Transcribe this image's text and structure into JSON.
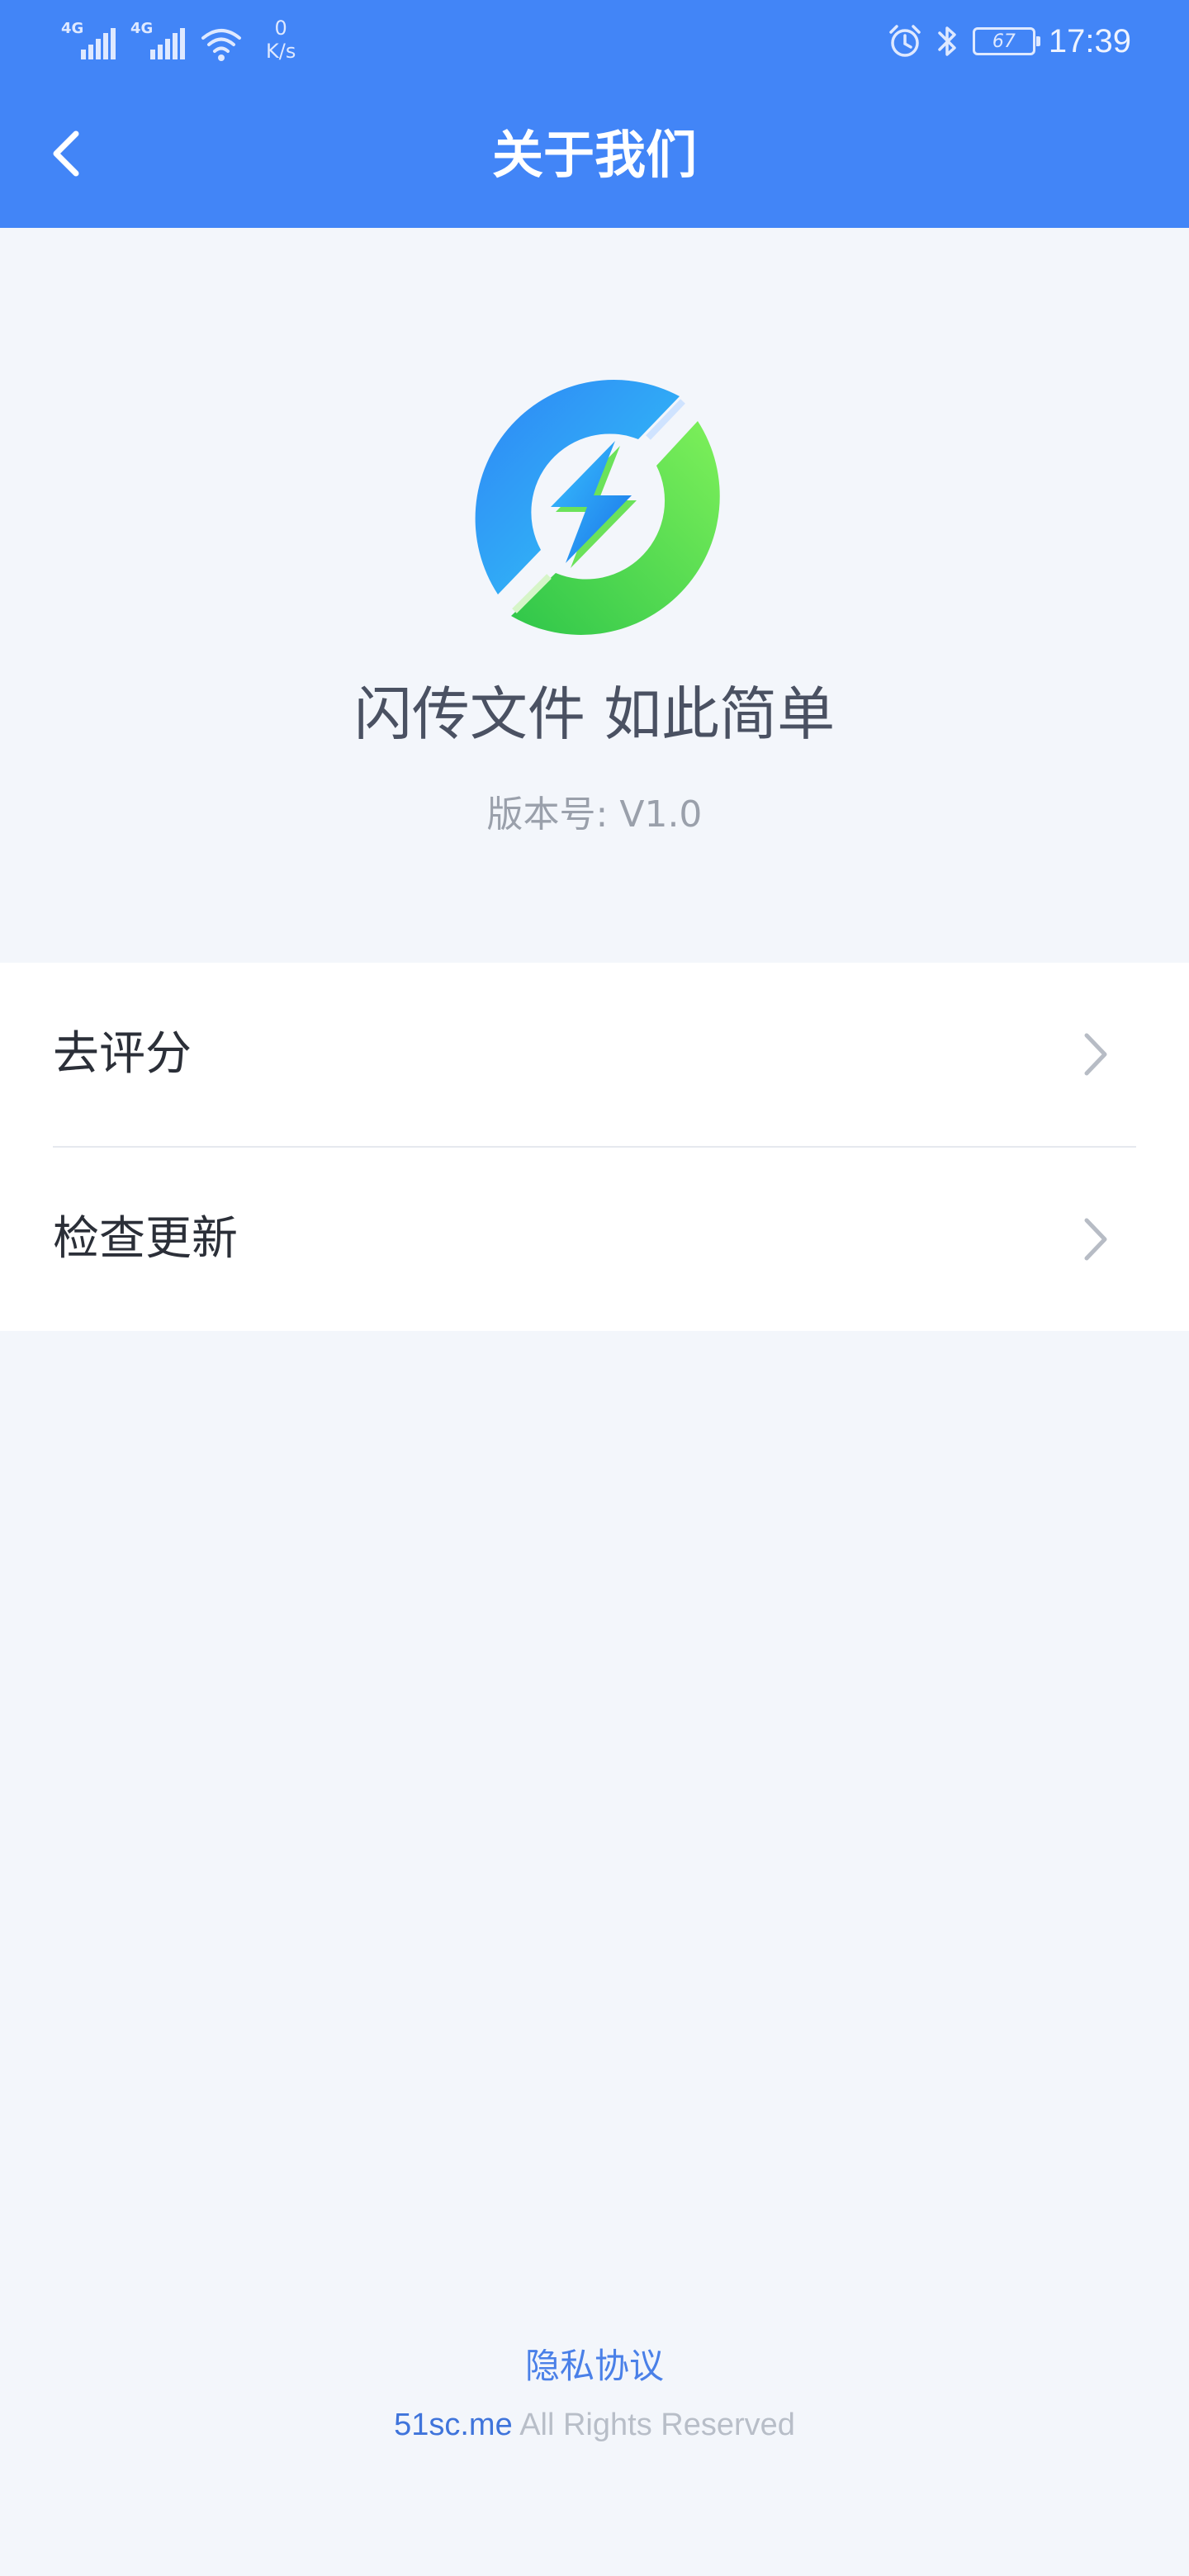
{
  "status_bar": {
    "signal1_tag": "4G",
    "signal2_tag": "4G",
    "net_speed_value": "0",
    "net_speed_unit": "K/s",
    "battery_level": "67",
    "time": "17:39"
  },
  "header": {
    "title": "关于我们",
    "background_color": "#4285f7"
  },
  "about": {
    "slogan": "闪传文件 如此简单",
    "version_label": "版本号: V1.0"
  },
  "menu": {
    "items": [
      {
        "label": "去评分"
      },
      {
        "label": "检查更新"
      }
    ]
  },
  "footer": {
    "privacy_link": "隐私协议",
    "domain": "51sc.me",
    "rights": "All Rights Reserved"
  },
  "icons": {
    "back": "chevron-left-icon",
    "menu_chevron": "chevron-right-icon",
    "alarm": "alarm-icon",
    "bluetooth": "bluetooth-icon",
    "wifi": "wifi-icon",
    "logo": "app-logo"
  }
}
